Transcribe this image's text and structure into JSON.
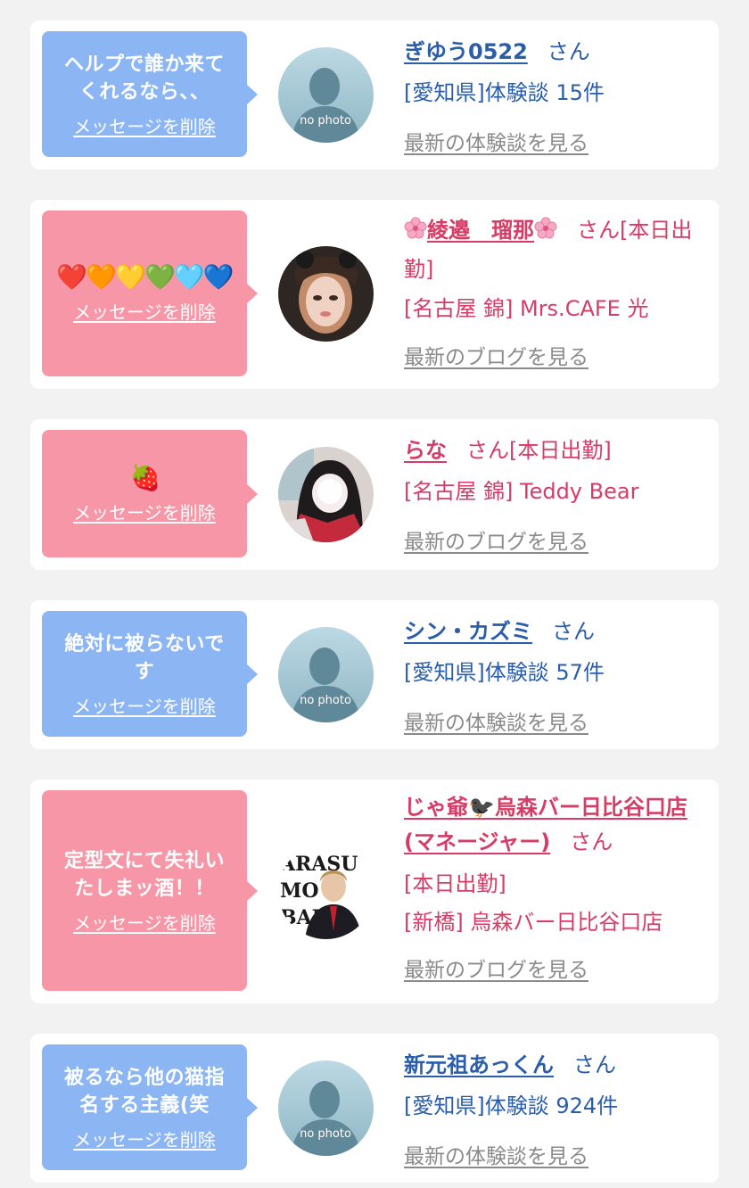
{
  "colors": {
    "background": "#f2f2f2",
    "bubble_blue": "#8cb6f3",
    "bubble_pink": "#f796a7",
    "name_blue": "#2a5daa",
    "name_pink": "#d63c66",
    "link_gray": "#8a8a8a"
  },
  "delete_label": "メッセージを削除",
  "items": [
    {
      "message": "ヘルプで誰か来て\nくれるなら、、",
      "name": "ぎゆう0522",
      "honorific": "さん",
      "line1": "[愛知県]体験談 15件",
      "link": "最新の体験談を見る",
      "avatar": "no photo"
    },
    {
      "message": "❤️🧡💛💚🩵💙",
      "name": "綾邉　瑠那",
      "honorific": "さん[本日出勤]",
      "line1": "[名古屋 錦] Mrs.CAFE 光",
      "link": "最新のブログを見る",
      "avatar": "photo"
    },
    {
      "message": "🍓",
      "name": "らな",
      "honorific": "さん[本日出勤]",
      "line1": "[名古屋 錦] Teddy Bear",
      "link": "最新のブログを見る",
      "avatar": "photo"
    },
    {
      "message": "絶対に被らないで\nす",
      "name": "シン・カズミ",
      "honorific": "さん",
      "line1": "[愛知県]体験談 57件",
      "link": "最新の体験談を見る",
      "avatar": "no photo"
    },
    {
      "message": "定型文にて失礼い\nたしまッ酒！！",
      "name": "じゃ爺🐦‍⬛烏森バー日比谷口店(マネージャー)",
      "honorific": "さん",
      "status": "[本日出勤]",
      "line1": "[新橋] 烏森バー日比谷口店",
      "link": "最新のブログを見る",
      "avatar": "photo"
    },
    {
      "message": "被るなら他の猫指\n名する主義(笑",
      "name": "新元祖あっくん",
      "honorific": "さん",
      "line1": "[愛知県]体験談 924件",
      "link": "最新の体験談を見る",
      "avatar": "no photo"
    }
  ]
}
